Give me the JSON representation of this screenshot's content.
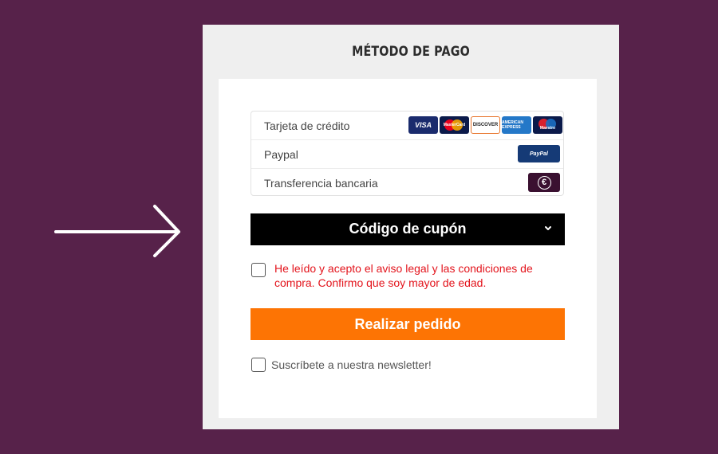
{
  "panel": {
    "title": "MÉTODO DE PAGO"
  },
  "payment_methods": [
    {
      "label": "Tarjeta de crédito",
      "logos": [
        "VISA",
        "MasterCard",
        "DISCOVER",
        "AMERICAN EXPRESS",
        "Maestro"
      ]
    },
    {
      "label": "Paypal",
      "logo": "PayPal"
    },
    {
      "label": "Transferencia bancaria",
      "logo": "€"
    }
  ],
  "coupon": {
    "label": "Código de cupón",
    "icon": "chevron-down-icon"
  },
  "terms": {
    "text": "He leído y acepto el aviso legal y las condiciones de compra. Confirmo que soy mayor de edad.",
    "checked": false
  },
  "order_button": {
    "label": "Realizar pedido"
  },
  "newsletter": {
    "text": "Suscríbete a nuestra newsletter!",
    "checked": false
  },
  "colors": {
    "background": "#57224a",
    "accent": "#fd7404",
    "terms_text": "#e3141c",
    "coupon_bar": "#000000"
  }
}
